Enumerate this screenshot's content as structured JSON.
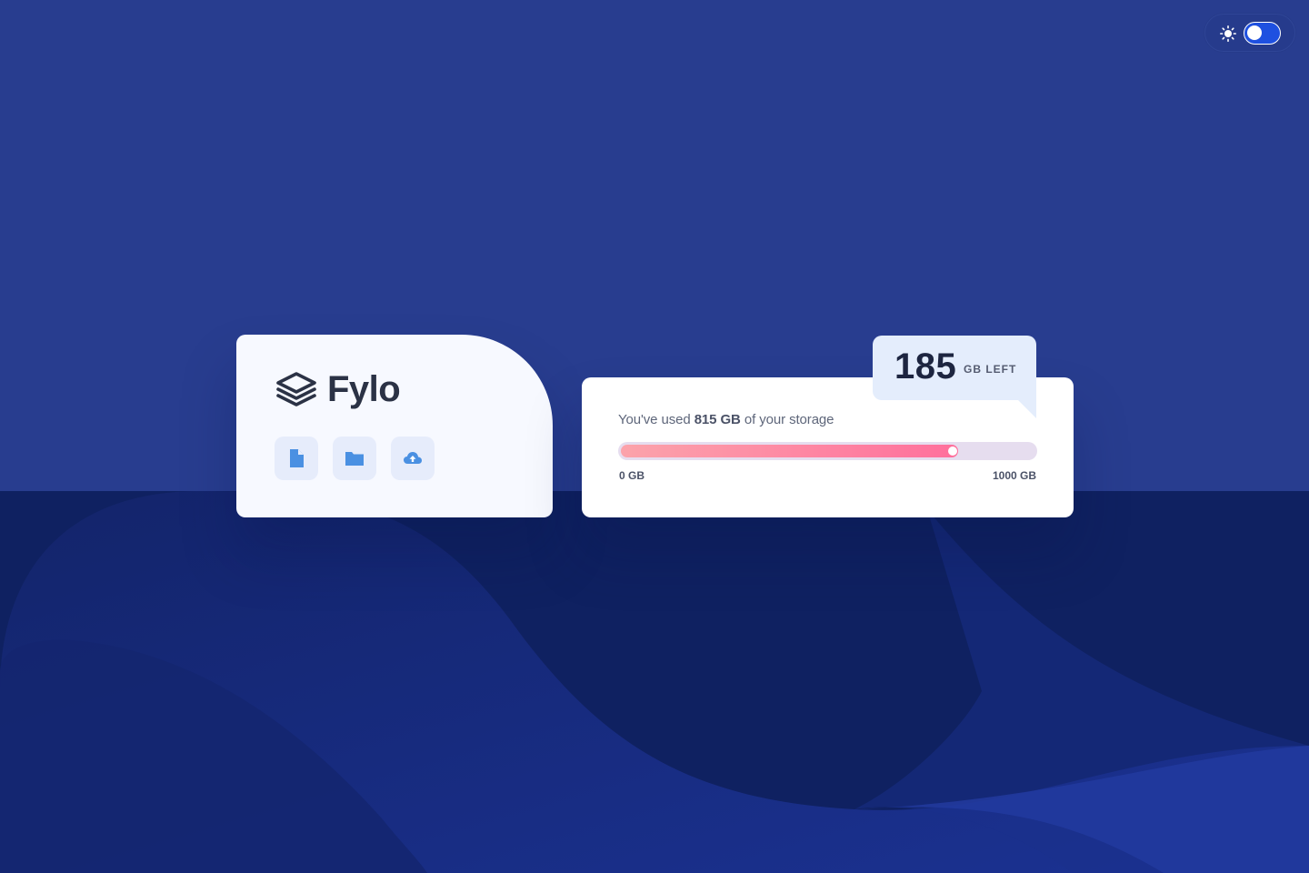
{
  "colors": {
    "background": "#283d8f",
    "wave_dark": "#112265",
    "wave_mid": "#1a3090",
    "card": "#ffffff",
    "accent": "#ff6f9c",
    "icon": "#4a90e2"
  },
  "theme_toggle": {
    "icon": "sun-icon",
    "state": "dark"
  },
  "logo": {
    "text": "Fylo",
    "icon": "stacked-layers-icon"
  },
  "actions": [
    {
      "name": "file-icon"
    },
    {
      "name": "folder-icon"
    },
    {
      "name": "upload-icon"
    }
  ],
  "storage": {
    "usage_prefix": "You've used ",
    "used": "815 GB",
    "usage_suffix": " of your storage",
    "used_fraction": 0.815,
    "scale_min": "0 GB",
    "scale_max": "1000 GB",
    "remaining_number": "185",
    "remaining_unit": "GB LEFT"
  }
}
